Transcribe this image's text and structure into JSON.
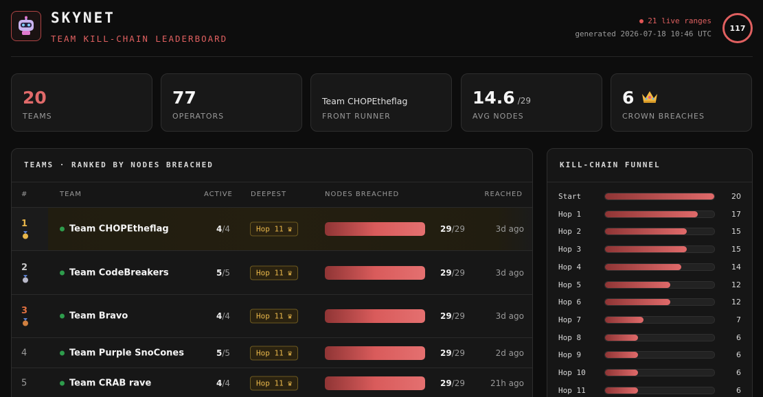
{
  "header": {
    "title": "SKYNET",
    "subtitle": "TEAM KILL-CHAIN LEADERBOARD",
    "live_text": "21 live ranges",
    "generated": "generated 2026-07-18 10:46 UTC",
    "ring_value": "117"
  },
  "stats": [
    {
      "value": "20",
      "suffix": "",
      "label": "TEAMS"
    },
    {
      "value": "77",
      "suffix": "",
      "label": "OPERATORS"
    },
    {
      "value": "Team CHOPEtheflag",
      "suffix": "",
      "label": "FRONT RUNNER"
    },
    {
      "value": "14.6",
      "suffix": "/29",
      "label": "AVG NODES"
    },
    {
      "value": "6",
      "suffix": "",
      "label": "CROWN BREACHES"
    }
  ],
  "teams_panel": {
    "title": "TEAMS · RANKED BY NODES BREACHED",
    "columns": [
      "#",
      "TEAM",
      "ACTIVE",
      "DEEPEST",
      "NODES BREACHED",
      "REACHED"
    ],
    "rows": [
      {
        "rank": "1",
        "name": "Team CHOPEtheflag",
        "active": "4",
        "active_total": "/4",
        "deepest": "Hop 11",
        "nodes": "29",
        "nodes_total": "/29",
        "progress": 1.0,
        "reached": "3d ago"
      },
      {
        "rank": "2",
        "name": "Team CodeBreakers",
        "active": "5",
        "active_total": "/5",
        "deepest": "Hop 11",
        "nodes": "29",
        "nodes_total": "/29",
        "progress": 1.0,
        "reached": "3d ago"
      },
      {
        "rank": "3",
        "name": "Team Bravo",
        "active": "4",
        "active_total": "/4",
        "deepest": "Hop 11",
        "nodes": "29",
        "nodes_total": "/29",
        "progress": 1.0,
        "reached": "3d ago"
      },
      {
        "rank": "4",
        "name": "Team Purple SnoCones",
        "active": "5",
        "active_total": "/5",
        "deepest": "Hop 11",
        "nodes": "29",
        "nodes_total": "/29",
        "progress": 1.0,
        "reached": "2d ago"
      },
      {
        "rank": "5",
        "name": "Team CRAB rave",
        "active": "4",
        "active_total": "/4",
        "deepest": "Hop 11",
        "nodes": "29",
        "nodes_total": "/29",
        "progress": 1.0,
        "reached": "21h ago"
      }
    ]
  },
  "funnel": {
    "title": "KILL-CHAIN FUNNEL",
    "max": 20,
    "stages": [
      {
        "label": "Start",
        "count": "20"
      },
      {
        "label": "Hop 1",
        "count": "17"
      },
      {
        "label": "Hop 2",
        "count": "15"
      },
      {
        "label": "Hop 3",
        "count": "15"
      },
      {
        "label": "Hop 4",
        "count": "14"
      },
      {
        "label": "Hop 5",
        "count": "12"
      },
      {
        "label": "Hop 6",
        "count": "12"
      },
      {
        "label": "Hop 7",
        "count": "7"
      },
      {
        "label": "Hop 8",
        "count": "6"
      },
      {
        "label": "Hop 9",
        "count": "6"
      },
      {
        "label": "Hop 10",
        "count": "6"
      },
      {
        "label": "Hop 11",
        "count": "6"
      }
    ]
  },
  "colors": {
    "accent": "#e06060",
    "gold": "#e8b64a",
    "silver": "#b8b8c8",
    "bronze": "#e07040",
    "online": "#2e9c4c"
  }
}
